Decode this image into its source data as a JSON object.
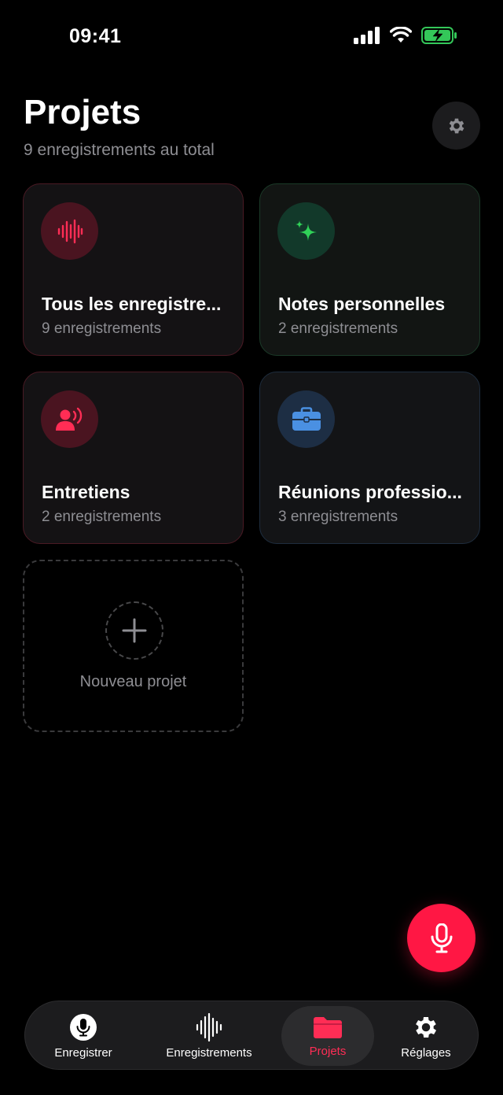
{
  "status_bar": {
    "time": "09:41"
  },
  "header": {
    "title": "Projets",
    "subtitle": "9 enregistrements au total"
  },
  "projects": [
    {
      "title": "Tous les enregistre...",
      "count": "9 enregistrements",
      "icon": "waveform-icon",
      "accent": "#ff2d55"
    },
    {
      "title": "Notes personnelles",
      "count": "2 enregistrements",
      "icon": "sparkles-icon",
      "accent": "#30d158"
    },
    {
      "title": "Entretiens",
      "count": "2 enregistrements",
      "icon": "person-speaking-icon",
      "accent": "#ff2d55"
    },
    {
      "title": "Réunions professio...",
      "count": "3 enregistrements",
      "icon": "briefcase-icon",
      "accent": "#4a90e2"
    }
  ],
  "new_project": {
    "label": "Nouveau projet"
  },
  "tabbar": {
    "items": [
      {
        "label": "Enregistrer",
        "icon": "microphone-icon"
      },
      {
        "label": "Enregistrements",
        "icon": "waveform-icon"
      },
      {
        "label": "Projets",
        "icon": "folder-icon",
        "active": true
      },
      {
        "label": "Réglages",
        "icon": "gear-icon"
      }
    ]
  }
}
